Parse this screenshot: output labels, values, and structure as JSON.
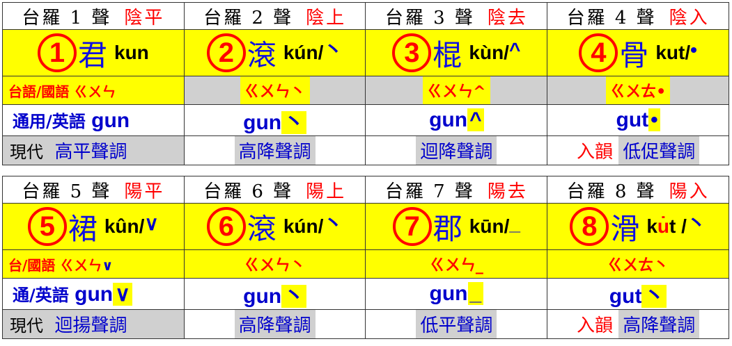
{
  "rows_1": {
    "titles": [
      {
        "label": "台羅 1 聲",
        "tone": "陰平"
      },
      {
        "label": "台羅 2 聲",
        "tone": "陰上"
      },
      {
        "label": "台羅 3 聲",
        "tone": "陰去"
      },
      {
        "label": "台羅 4 聲",
        "tone": "陰入"
      }
    ],
    "main": [
      {
        "num": "1",
        "char": "君",
        "rom": "kun",
        "mark": ""
      },
      {
        "num": "2",
        "char": "滾",
        "rom": "kún/",
        "mark": "丶"
      },
      {
        "num": "3",
        "char": "棍",
        "rom": "kùn/",
        "mark": "^"
      },
      {
        "num": "4",
        "char": "骨",
        "rom": "kut/",
        "mark": "•"
      }
    ],
    "bopo": [
      "台語/國語 ㄍㄨㄣ",
      "ㄍㄨㄣ丶",
      "ㄍㄨㄣ^",
      "ㄍㄨㄊ•"
    ],
    "gun_label": "通用/英語",
    "gun": [
      {
        "text": "gun",
        "mark": ""
      },
      {
        "text": "gun",
        "mark": "丶"
      },
      {
        "text": "gun",
        "mark": "^"
      },
      {
        "text": "gut",
        "mark": "•"
      }
    ],
    "modern_label": "現代",
    "modern": [
      "高平聲調",
      "高降聲調",
      "迴降聲調",
      "低促聲調"
    ],
    "entering_label": "入韻"
  },
  "rows_2": {
    "titles": [
      {
        "label": "台羅 5 聲",
        "tone": "陽平"
      },
      {
        "label": "台羅 6 聲",
        "tone": "陽上"
      },
      {
        "label": "台羅 7 聲",
        "tone": "陽去"
      },
      {
        "label": "台羅 8 聲",
        "tone": "陽入"
      }
    ],
    "main": [
      {
        "num": "5",
        "char": "裙",
        "rom": "kûn/",
        "mark": "∨"
      },
      {
        "num": "6",
        "char": "滾",
        "rom": "kún/",
        "mark": "丶"
      },
      {
        "num": "7",
        "char": "郡",
        "rom": "kūn/",
        "mark": "_"
      },
      {
        "num": "8",
        "char": "滑",
        "rom_pre": "k",
        "rom_dot": "u̇",
        "rom_post": "t /",
        "mark": "丶"
      }
    ],
    "bopo": [
      "台/國語 ㄍㄨㄣ",
      "ㄍㄨㄣ丶",
      "ㄍㄨㄣ_",
      "ㄍㄨㄊ丶"
    ],
    "bopo_first_mark": "∨",
    "gun_label": "通/英語",
    "gun": [
      {
        "text": "gun",
        "mark": "∨"
      },
      {
        "text": "gun",
        "mark": "丶"
      },
      {
        "text": "gun",
        "mark": "_"
      },
      {
        "text": "gut",
        "mark": "丶"
      }
    ],
    "modern_label": "現代",
    "modern": [
      "迴揚聲調",
      "高降聲調",
      "低平聲調",
      "高降聲調"
    ],
    "entering_label": "入韻"
  },
  "colors": {
    "accent": "#ff0000",
    "text_blue": "#0000cc",
    "highlight": "#ffff00",
    "grey": "#d0d0d0"
  }
}
